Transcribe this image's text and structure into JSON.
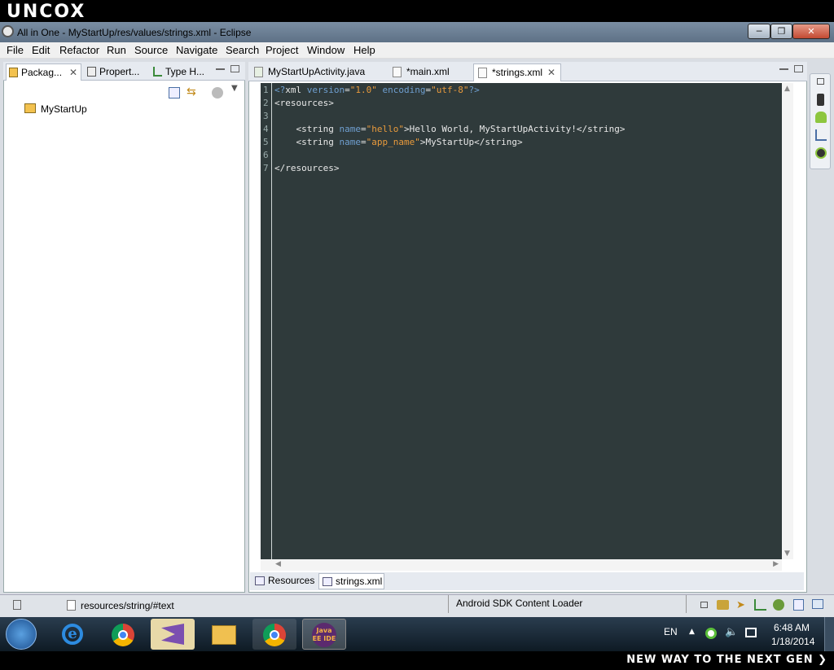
{
  "brand": {
    "logo_text": "UNCOX",
    "footer_text": "NEW WAY TO THE NEXT GEN ❯"
  },
  "window": {
    "title": "All in One - MyStartUp/res/values/strings.xml - Eclipse"
  },
  "menu": [
    "File",
    "Edit",
    "Refactor",
    "Run",
    "Source",
    "Navigate",
    "Search",
    "Project",
    "Window",
    "Help"
  ],
  "left_panel": {
    "tabs": [
      {
        "label": "Packag...",
        "icon": "package-explorer-icon"
      },
      {
        "label": "Propert...",
        "icon": "properties-icon"
      },
      {
        "label": "Type H...",
        "icon": "type-hierarchy-icon"
      }
    ],
    "tree": [
      {
        "label": "MyStartUp",
        "icon": "project-folder-icon"
      }
    ]
  },
  "editor": {
    "tabs": [
      {
        "label": "MyStartUpActivity.java"
      },
      {
        "label": "*main.xml"
      },
      {
        "label": "*strings.xml",
        "active": true
      }
    ],
    "lines": [
      {
        "n": "1",
        "segs": [
          {
            "t": "<?",
            "c": "c-pi"
          },
          {
            "t": "xml ",
            "c": ""
          },
          {
            "t": "version",
            "c": "c-attr"
          },
          {
            "t": "=",
            "c": ""
          },
          {
            "t": "\"1.0\"",
            "c": "c-val"
          },
          {
            "t": " ",
            "c": ""
          },
          {
            "t": "encoding",
            "c": "c-attr"
          },
          {
            "t": "=",
            "c": ""
          },
          {
            "t": "\"utf-8\"",
            "c": "c-val"
          },
          {
            "t": "?>",
            "c": "c-pi"
          }
        ]
      },
      {
        "n": "2",
        "segs": [
          {
            "t": "<resources>",
            "c": ""
          }
        ]
      },
      {
        "n": "3",
        "segs": []
      },
      {
        "n": "4",
        "segs": [
          {
            "t": "    <string ",
            "c": ""
          },
          {
            "t": "name",
            "c": "c-attr"
          },
          {
            "t": "=",
            "c": ""
          },
          {
            "t": "\"hello\"",
            "c": "c-val"
          },
          {
            "t": ">Hello World, MyStartUpActivity!</string>",
            "c": ""
          }
        ]
      },
      {
        "n": "5",
        "segs": [
          {
            "t": "    <string ",
            "c": ""
          },
          {
            "t": "name",
            "c": "c-attr"
          },
          {
            "t": "=",
            "c": ""
          },
          {
            "t": "\"app_name\"",
            "c": "c-val"
          },
          {
            "t": ">MyStartUp</string>",
            "c": ""
          }
        ]
      },
      {
        "n": "6",
        "segs": []
      },
      {
        "n": "7",
        "segs": [
          {
            "t": "</resources>",
            "c": ""
          }
        ]
      }
    ],
    "bottom_tabs": [
      {
        "label": "Resources"
      },
      {
        "label": "strings.xml",
        "active": true
      }
    ]
  },
  "status": {
    "path": "resources/string/#text",
    "task": "Android SDK Content Loader"
  },
  "taskbar": {
    "lang": "EN",
    "time": "6:48 AM",
    "date": "1/18/2014",
    "java_ee_label": "Java EE IDE"
  }
}
